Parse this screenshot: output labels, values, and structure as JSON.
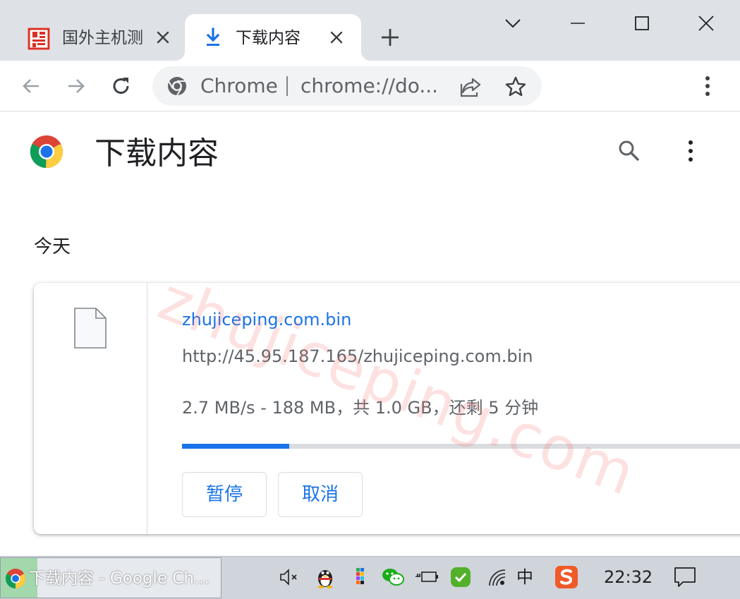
{
  "tabs": [
    {
      "title": "国外主机测",
      "active": false,
      "icon": "site-favicon"
    },
    {
      "title": "下载内容",
      "active": true,
      "icon": "download-icon"
    }
  ],
  "window": {
    "controls": [
      "chevron-down-icon",
      "minimize-icon",
      "maximize-icon",
      "close-icon"
    ]
  },
  "toolbar": {
    "omnibox_chip": "Chrome",
    "omnibox_url": "chrome://do..."
  },
  "page": {
    "title": "下载内容",
    "section_date": "今天"
  },
  "download": {
    "file_name": "zhujiceping.com.bin",
    "url": "http://45.95.187.165/zhujiceping.com.bin",
    "status": "2.7 MB/s - 188 MB，共 1.0 GB，还剩 5 分钟",
    "progress": 0.188,
    "pause_label": "暂停",
    "cancel_label": "取消"
  },
  "watermark": "zhujiceping.com",
  "taskbar": {
    "task_label": "下载内容 - Google Ch...",
    "ime_label": "中",
    "clock": "22:32"
  },
  "colors": {
    "accent": "#1a73e8",
    "tabstrip": "#dee1e6",
    "taskbar": "#d0d4db"
  }
}
